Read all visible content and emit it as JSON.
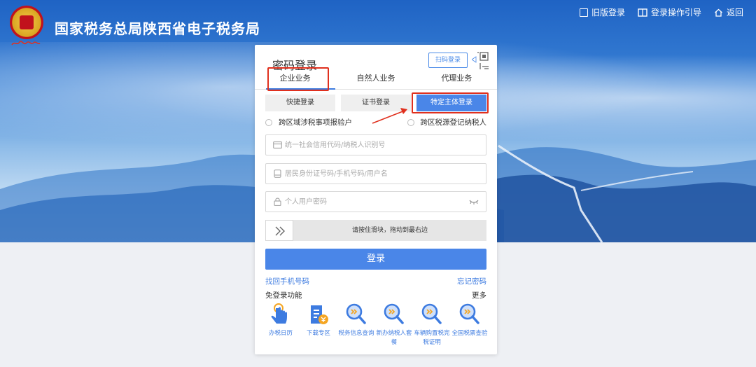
{
  "header": {
    "site_title": "国家税务总局陕西省电子税务局",
    "nav": [
      {
        "label": "旧版登录",
        "icon": "old-login-icon"
      },
      {
        "label": "登录操作引导",
        "icon": "guide-book-icon"
      },
      {
        "label": "返回",
        "icon": "home-icon"
      }
    ]
  },
  "login": {
    "title": "密码登录",
    "scan_label": "扫码登录",
    "biz_tabs": [
      "企业业务",
      "自然人业务",
      "代理业务"
    ],
    "active_biz_tab": "企业业务",
    "modes": [
      "快捷登录",
      "证书登录",
      "特定主体登录"
    ],
    "active_mode": "特定主体登录",
    "radios": [
      "跨区域涉税事项报验户",
      "跨区税源登记纳税人"
    ],
    "fields": {
      "credit_code_placeholder": "统一社会信用代码/纳税人识别号",
      "id_placeholder": "居民身份证号码/手机号码/用户名",
      "password_placeholder": "个人用户密码"
    },
    "slider_hint": "请按住滑块，拖动到最右边",
    "submit_label": "登录",
    "retrieve_phone": "找回手机号码",
    "forgot_password": "忘记密码",
    "free_login_title": "免登录功能",
    "more_label": "更多",
    "functions": [
      {
        "label": "办税日历",
        "icon": "hand-tap-icon"
      },
      {
        "label": "下载专区",
        "icon": "download-document-icon"
      },
      {
        "label": "税务信息查询",
        "icon": "search-icon"
      },
      {
        "label": "新办纳税人套餐",
        "icon": "search-icon"
      },
      {
        "label": "车辆购置税完税证明",
        "icon": "search-icon"
      },
      {
        "label": "全国税票查验",
        "icon": "search-icon"
      }
    ]
  },
  "colors": {
    "accent": "#4a86e8",
    "highlight_red": "#e0301e",
    "link_blue": "#3d7be0"
  }
}
